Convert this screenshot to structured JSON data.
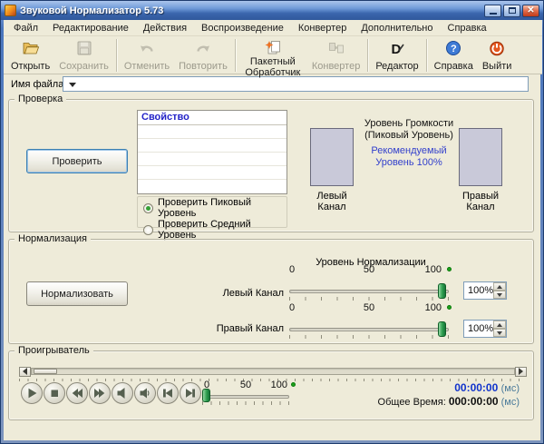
{
  "window": {
    "title": "Звуковой Нормализатор 5.73"
  },
  "menu": {
    "items": [
      "Файл",
      "Редактирование",
      "Действия",
      "Воспроизведение",
      "Конвертер",
      "Дополнительно",
      "Справка"
    ]
  },
  "toolbar": {
    "buttons": [
      {
        "label": "Открыть",
        "enabled": true
      },
      {
        "label": "Сохранить",
        "enabled": false
      },
      {
        "label": "Отменить",
        "enabled": false
      },
      {
        "label": "Повторить",
        "enabled": false
      },
      {
        "label": "Пакетный Обработчик",
        "enabled": true
      },
      {
        "label": "Конвертер",
        "enabled": false
      },
      {
        "label": "Редактор",
        "enabled": true
      },
      {
        "label": "Справка",
        "enabled": true
      },
      {
        "label": "Выйти",
        "enabled": true
      }
    ]
  },
  "file": {
    "label": "Имя файла:",
    "value": ""
  },
  "check": {
    "group_title": "Проверка",
    "button": "Проверить",
    "table_header": "Свойство",
    "radio_peak": "Проверить Пиковый Уровень",
    "radio_mean": "Проверить Средний Уровень",
    "radio_selected": "Проверить Пиковый Уровень",
    "volume_title": "Уровень Громкости (Пиковый Уровень)",
    "recommended": "Рекомендуемый Уровень 100%",
    "left_channel_label": "Левый Канал",
    "right_channel_label": "Правый Канал"
  },
  "normalization": {
    "group_title": "Нормализация",
    "button": "Нормализовать",
    "level_title": "Уровень Нормализации",
    "scale": {
      "min": "0",
      "mid": "50",
      "max": "100"
    },
    "left": {
      "label": "Левый Канал",
      "value": "100%"
    },
    "right": {
      "label": "Правый Канал",
      "value": "100%"
    }
  },
  "player": {
    "group_title": "Проигрыватель",
    "scale": {
      "min": "0",
      "mid": "50",
      "max": "100"
    },
    "current_time": "00:00:00",
    "current_unit": "(мс)",
    "total_label": "Общее Время:",
    "total_time": "000:00:00",
    "total_unit": "(мс)"
  },
  "colors": {
    "titlebar_blue": "#3b66ad",
    "window_bg": "#eeebd9",
    "table_header_blue": "#2323c8",
    "recommended_blue": "#3340cc",
    "slider_green": "#2e9e4f",
    "time_blue": "#1133cc",
    "channel_meter_fill": "#c9c9d9"
  }
}
